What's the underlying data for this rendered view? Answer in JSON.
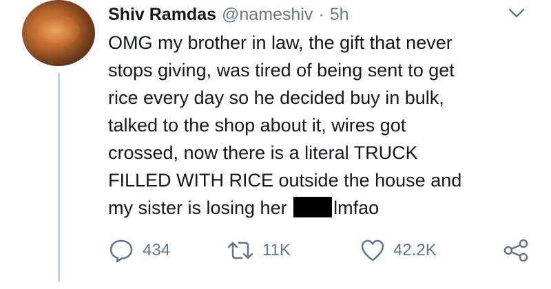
{
  "tweet": {
    "author_name": "Shiv Ramdas",
    "author_handle": "@nameshiv",
    "separator": "·",
    "time": "5h",
    "lines": [
      "OMG my brother in law, the gift that never",
      "stops giving, was tired of being sent to get",
      "rice every day so he decided buy in bulk,",
      "talked to the shop about it, wires got",
      "crossed, now there is a literal TRUCK",
      "FILLED WITH RICE outside the house and"
    ],
    "last_line_before": "my sister is losing her",
    "last_line_after": "lmfao"
  },
  "actions": {
    "reply_count": "434",
    "retweet_count": "11K",
    "like_count": "42.2K"
  },
  "icons": {
    "reply": "reply-icon",
    "retweet": "retweet-icon",
    "like": "heart-icon",
    "share": "share-icon",
    "menu": "chevron-down-icon"
  },
  "colors": {
    "text": "#14171a",
    "muted": "#657786",
    "thread_line": "#c4cfd6"
  }
}
